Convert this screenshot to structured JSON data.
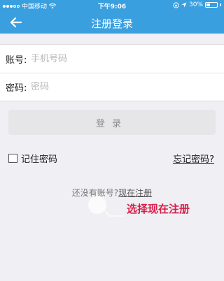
{
  "statusbar": {
    "carrier": "中国移动",
    "time": "下午9:06",
    "battery": "30%",
    "signal_icon": "signal-dots-icon",
    "wifi_icon": "wifi-icon",
    "lock_icon": "orientation-lock-icon",
    "location_icon": "location-arrow-icon"
  },
  "navbar": {
    "title": "注册登录",
    "back_icon": "arrow-left-icon"
  },
  "form": {
    "account_label": "账号:",
    "account_placeholder": "手机号码",
    "password_label": "密码:",
    "password_placeholder": "密码"
  },
  "login_button": "登录",
  "remember_label": "记住密码",
  "forgot_link": "忘记密码?",
  "register": {
    "prompt": "还没有账号?",
    "link": "现在注册"
  },
  "annotation": "选择现在注册",
  "colors": {
    "primary": "#3a9fdf",
    "background": "#efeff4",
    "annotation": "#d81e48"
  }
}
